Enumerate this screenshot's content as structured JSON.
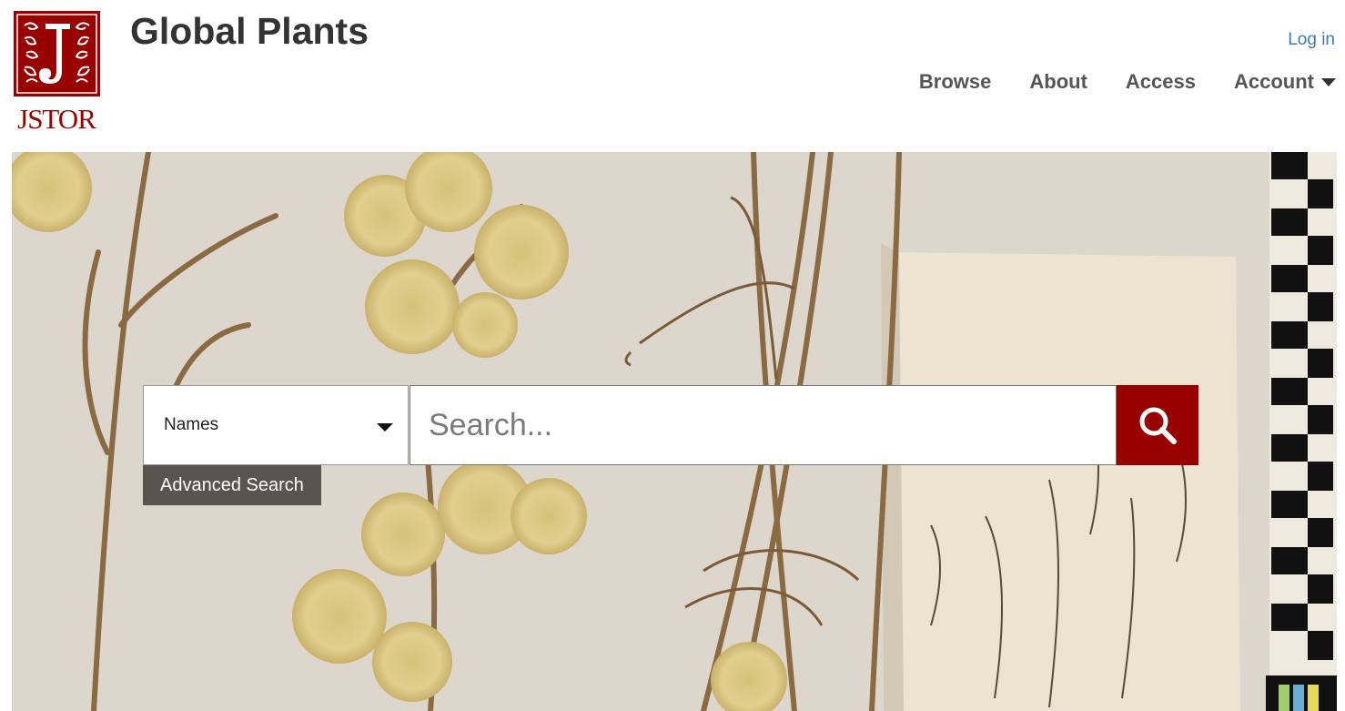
{
  "header": {
    "logo_text": "JSTOR",
    "site_title": "Global Plants",
    "login_label": "Log in"
  },
  "nav": {
    "browse": "Browse",
    "about": "About",
    "access": "Access",
    "account": "Account"
  },
  "search": {
    "selected_type": "Names",
    "placeholder": "Search...",
    "advanced_label": "Advanced Search"
  },
  "colors": {
    "brand_red": "#990000",
    "link_blue": "#3a7ab8",
    "nav_text": "#555555",
    "advanced_bg": "#5a544f"
  },
  "icons": {
    "search": "magnifier-icon",
    "dropdown": "caret-down-icon"
  }
}
